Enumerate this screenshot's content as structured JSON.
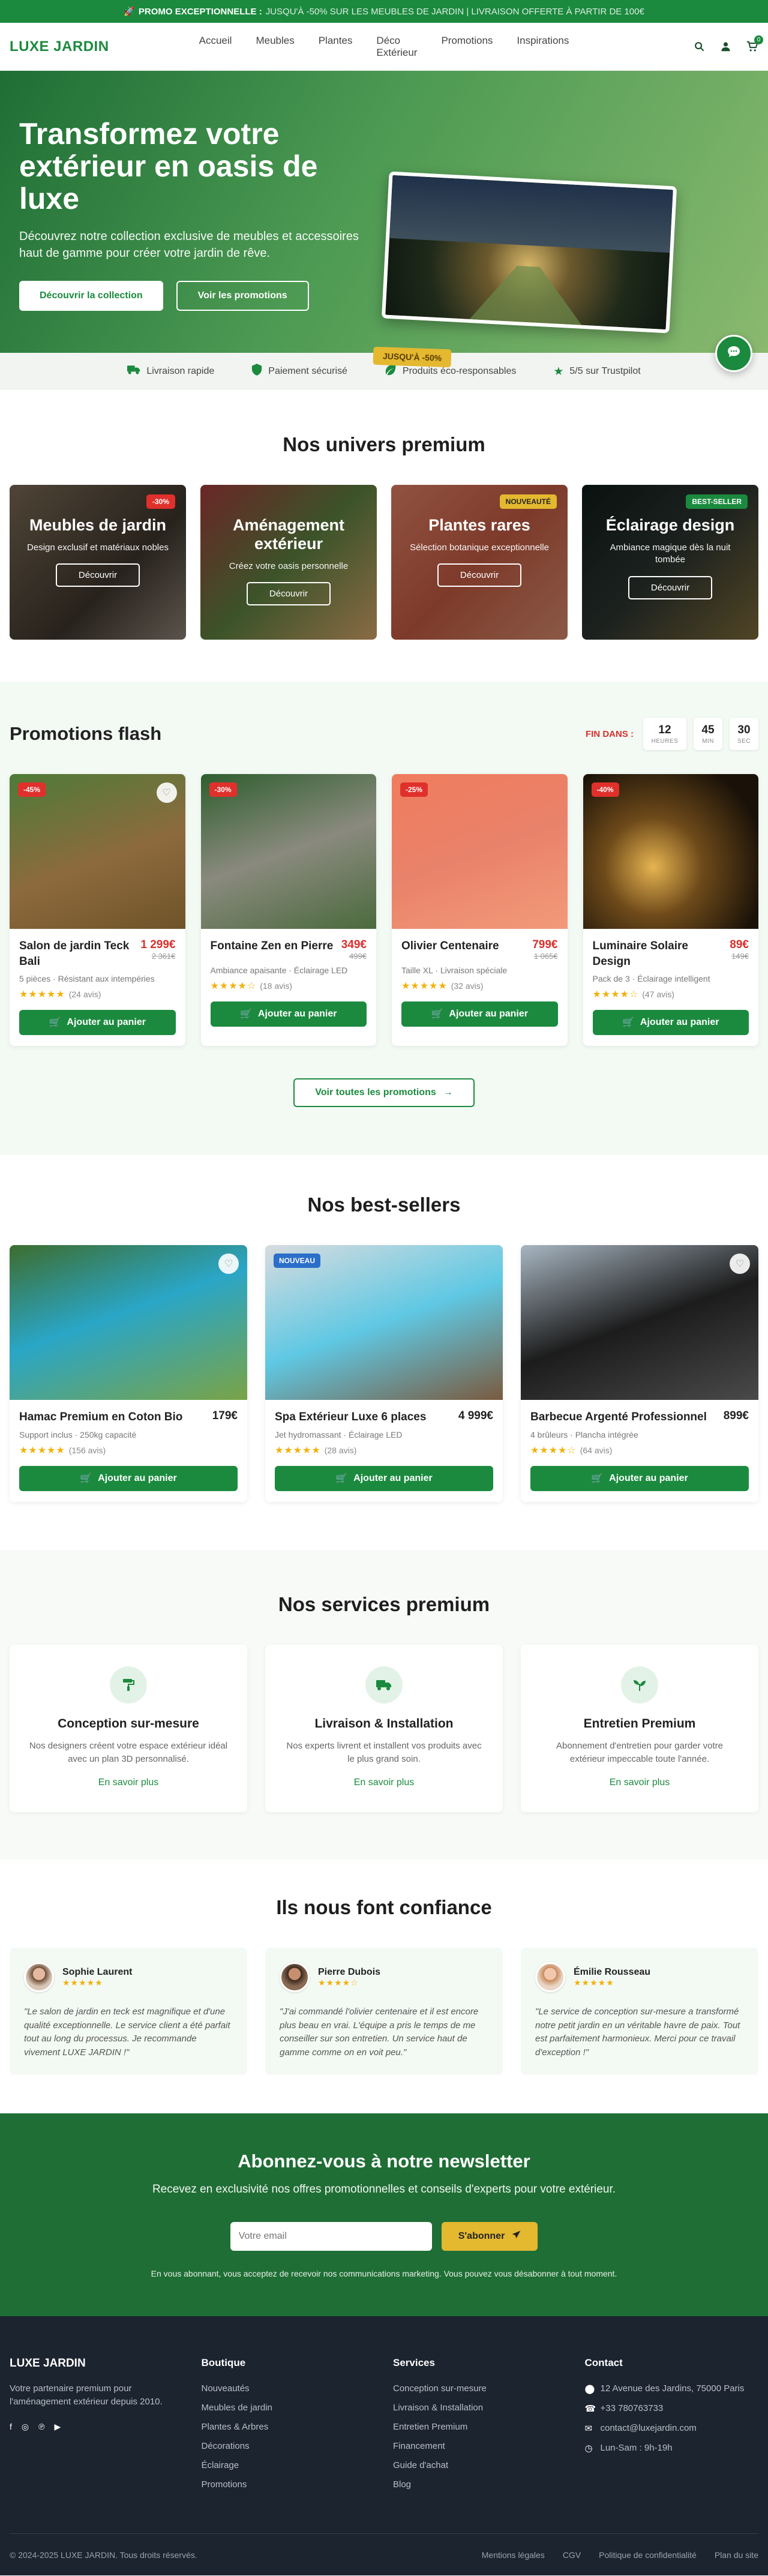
{
  "promo_bar": {
    "emoji": "🚀",
    "bold": "PROMO EXCEPTIONNELLE :",
    "text": "JUSQU'À -50% SUR LES MEUBLES DE JARDIN | LIVRAISON OFFERTE À PARTIR DE 100€"
  },
  "header": {
    "logo": "LUXE JARDIN",
    "nav": [
      "Accueil",
      "Meubles",
      "Plantes",
      "Déco Extérieur",
      "Promotions",
      "Inspirations"
    ],
    "cart_count": "0"
  },
  "hero": {
    "title": "Transformez votre extérieur en oasis de luxe",
    "subtitle": "Découvrez notre collection exclusive de meubles et accessoires haut de gamme pour créer votre jardin de rêve.",
    "btn_primary": "Découvrir la collection",
    "btn_secondary": "Voir les promotions",
    "badge": "JUSQU'À -50%"
  },
  "trust": [
    {
      "icon": "truck-icon",
      "label": "Livraison rapide"
    },
    {
      "icon": "shield-icon",
      "label": "Paiement sécurisé"
    },
    {
      "icon": "leaf-icon",
      "label": "Produits éco-responsables"
    },
    {
      "icon": "star-icon",
      "label": "5/5 sur Trustpilot"
    }
  ],
  "universes": {
    "title": "Nos univers premium",
    "cards": [
      {
        "title": "Meubles de jardin",
        "desc": "Design exclusif et matériaux nobles",
        "btn": "Découvrir",
        "tag": "-30%"
      },
      {
        "title": "Aménagement extérieur",
        "desc": "Créez votre oasis personnelle",
        "btn": "Découvrir",
        "tag": ""
      },
      {
        "title": "Plantes rares",
        "desc": "Sélection botanique exceptionnelle",
        "btn": "Découvrir",
        "tag": "NOUVEAUTÉ"
      },
      {
        "title": "Éclairage design",
        "desc": "Ambiance magique dès la nuit tombée",
        "btn": "Découvrir",
        "tag": "BEST-SELLER"
      }
    ]
  },
  "flash": {
    "title": "Promotions flash",
    "countdown_label": "FIN DANS :",
    "countdown": [
      {
        "value": "12",
        "unit": "HEURES"
      },
      {
        "value": "45",
        "unit": "MIN"
      },
      {
        "value": "30",
        "unit": "SEC"
      }
    ],
    "add_label": "Ajouter au panier",
    "see_all": "Voir toutes les promotions",
    "products": [
      {
        "badge": "-45%",
        "name": "Salon de jardin Teck Bali",
        "price": "1 299€",
        "old": "2 361€",
        "desc": "5 pièces · Résistant aux intempéries",
        "reviews": "(24 avis)"
      },
      {
        "badge": "-30%",
        "name": "Fontaine Zen en Pierre",
        "price": "349€",
        "old": "499€",
        "desc": "Ambiance apaisante · Éclairage LED",
        "reviews": "(18 avis)"
      },
      {
        "badge": "-25%",
        "name": "Olivier Centenaire",
        "price": "799€",
        "old": "1 065€",
        "desc": "Taille XL · Livraison spéciale",
        "reviews": "(32 avis)"
      },
      {
        "badge": "-40%",
        "name": "Luminaire Solaire Design",
        "price": "89€",
        "old": "149€",
        "desc": "Pack de 3 · Éclairage intelligent",
        "reviews": "(47 avis)"
      }
    ]
  },
  "best": {
    "title": "Nos best-sellers",
    "add_label": "Ajouter au panier",
    "products": [
      {
        "badge": "",
        "name": "Hamac Premium en Coton Bio",
        "price": "179€",
        "desc": "Support inclus · 250kg capacité",
        "reviews": "(156 avis)"
      },
      {
        "badge": "NOUVEAU",
        "name": "Spa Extérieur Luxe 6 places",
        "price": "4 999€",
        "desc": "Jet hydromassant · Éclairage LED",
        "reviews": "(28 avis)"
      },
      {
        "badge": "",
        "name": "Barbecue Argenté Professionnel",
        "price": "899€",
        "desc": "4 brûleurs · Plancha intégrée",
        "reviews": "(64 avis)"
      }
    ]
  },
  "services": {
    "title": "Nos services premium",
    "link": "En savoir plus",
    "items": [
      {
        "icon": "paint-roller-icon",
        "title": "Conception sur-mesure",
        "desc": "Nos designers créent votre espace extérieur idéal avec un plan 3D personnalisé."
      },
      {
        "icon": "truck-icon",
        "title": "Livraison & Installation",
        "desc": "Nos experts livrent et installent vos produits avec le plus grand soin."
      },
      {
        "icon": "seedling-icon",
        "title": "Entretien Premium",
        "desc": "Abonnement d'entretien pour garder votre extérieur impeccable toute l'année."
      }
    ]
  },
  "testimonials": {
    "title": "Ils nous font confiance",
    "items": [
      {
        "name": "Sophie Laurent",
        "text": "\"Le salon de jardin en teck est magnifique et d'une qualité exceptionnelle. Le service client a été parfait tout au long du processus. Je recommande vivement LUXE JARDIN !\""
      },
      {
        "name": "Pierre Dubois",
        "text": "\"J'ai commandé l'olivier centenaire et il est encore plus beau en vrai. L'équipe a pris le temps de me conseiller sur son entretien. Un service haut de gamme comme on en voit peu.\""
      },
      {
        "name": "Émilie Rousseau",
        "text": "\"Le service de conception sur-mesure a transformé notre petit jardin en un véritable havre de paix. Tout est parfaitement harmonieux. Merci pour ce travail d'exception !\""
      }
    ]
  },
  "newsletter": {
    "title": "Abonnez-vous à notre newsletter",
    "subtitle": "Recevez en exclusivité nos offres promotionnelles et conseils d'experts pour votre extérieur.",
    "placeholder": "Votre email",
    "btn": "S'abonner",
    "legal": "En vous abonnant, vous acceptez de recevoir nos communications marketing. Vous pouvez vous désabonner à tout moment."
  },
  "footer": {
    "brand": "LUXE JARDIN",
    "about": "Votre partenaire premium pour l'aménagement extérieur depuis 2010.",
    "col_boutique": "Boutique",
    "boutique": [
      "Nouveautés",
      "Meubles de jardin",
      "Plantes & Arbres",
      "Décorations",
      "Éclairage",
      "Promotions"
    ],
    "col_services": "Services",
    "services": [
      "Conception sur-mesure",
      "Livraison & Installation",
      "Entretien Premium",
      "Financement",
      "Guide d'achat",
      "Blog"
    ],
    "col_contact": "Contact",
    "address": "12 Avenue des Jardins, 75000 Paris",
    "phone": "+33 780763733",
    "email": "contact@luxejardin.com",
    "hours": "Lun-Sam : 9h-19h",
    "copyright": "© 2024-2025 LUXE JARDIN. Tous droits réservés.",
    "legal_links": [
      "Mentions légales",
      "CGV",
      "Politique de confidentialité",
      "Plan du site"
    ]
  }
}
